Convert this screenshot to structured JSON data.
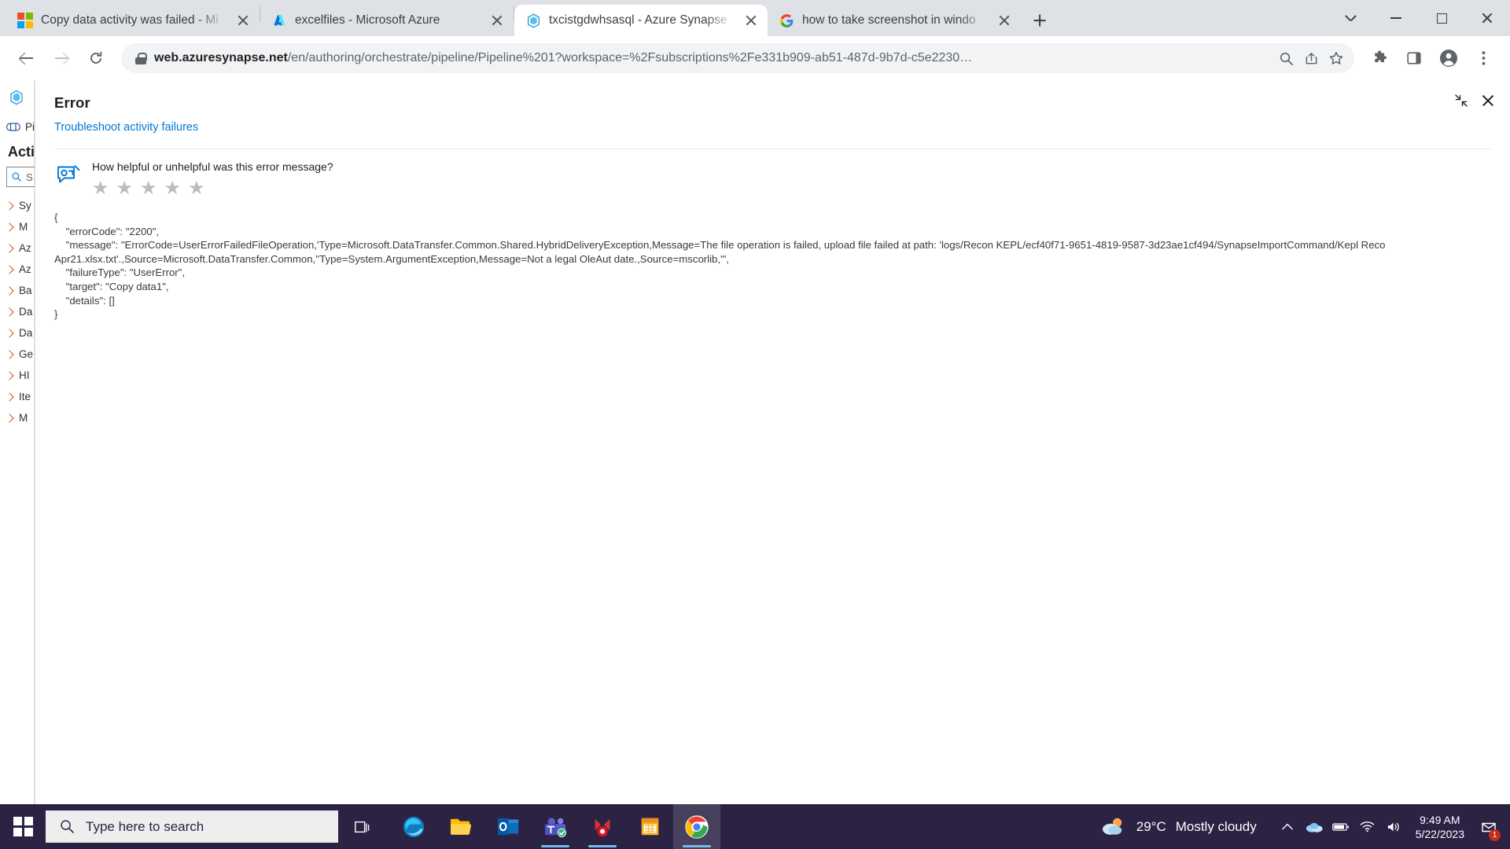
{
  "browser": {
    "tabs": [
      {
        "title": "Copy data activity was failed - Mi",
        "favicon": "microsoft-icon",
        "active": false
      },
      {
        "title": "excelfiles - Microsoft Azure",
        "favicon": "azure-icon",
        "active": false
      },
      {
        "title": "txcistgdwhsasql - Azure Synapse",
        "favicon": "synapse-icon",
        "active": true
      },
      {
        "title": "how to take screenshot in windo",
        "favicon": "google-icon",
        "active": false
      }
    ],
    "new_tab_label": "+",
    "window_controls": {
      "minimize": "–",
      "maximize": "□",
      "close": "✕",
      "tablist": "⌄"
    },
    "toolbar": {
      "back_label": "Back",
      "forward_label": "Forward",
      "reload_label": "Reload",
      "url_domain": "web.azuresynapse.net",
      "url_path": "/en/authoring/orchestrate/pipeline/Pipeline%201?workspace=%2Fsubscriptions%2Fe331b909-ab51-487d-9b7d-c5e2230…",
      "zoom_label": "Search with Google Lens",
      "share_label": "Share this page",
      "bookmark_label": "Bookmark this tab",
      "extensions_label": "Extensions",
      "sidepanel_label": "Side panel",
      "profile_label": "Profile",
      "menu_label": "Customize and control Google Chrome"
    }
  },
  "synapse": {
    "logo": "synapse-icon",
    "pipeline_label": "Pi",
    "panel_heading": "Acti",
    "search_placeholder": "S",
    "tree_items": [
      {
        "label": "Sy"
      },
      {
        "label": "M"
      },
      {
        "label": "Az"
      },
      {
        "label": "Az"
      },
      {
        "label": "Ba"
      },
      {
        "label": "Da"
      },
      {
        "label": "Da"
      },
      {
        "label": "Ge"
      },
      {
        "label": "HI"
      },
      {
        "label": "Ite"
      },
      {
        "label": "M"
      }
    ]
  },
  "error_panel": {
    "title": "Error",
    "troubleshoot_link": "Troubleshoot activity failures",
    "feedback_question": "How helpful or unhelpful was this error message?",
    "stars": [
      "★",
      "★",
      "★",
      "★",
      "★"
    ],
    "stars_selected": 0,
    "star_color": "#bdbdbd",
    "collapse_label": "Collapse",
    "close_label": "Close",
    "json": "{\n    \"errorCode\": \"2200\",\n    \"message\": \"ErrorCode=UserErrorFailedFileOperation,'Type=Microsoft.DataTransfer.Common.Shared.HybridDeliveryException,Message=The file operation is failed, upload file failed at path: 'logs/Recon KEPL/ecf40f71-9651-4819-9587-3d23ae1cf494/SynapseImportCommand/Kepl Reco Apr21.xlsx.txt'.,Source=Microsoft.DataTransfer.Common,''Type=System.ArgumentException,Message=Not a legal OleAut date.,Source=mscorlib,'\",\n    \"failureType\": \"UserError\",\n    \"target\": \"Copy data1\",\n    \"details\": []\n}"
  },
  "taskbar": {
    "start_label": "Start",
    "search_placeholder": "Type here to search",
    "task_view_label": "Task View",
    "apps": [
      {
        "name": "edge-icon"
      },
      {
        "name": "file-explorer-icon"
      },
      {
        "name": "outlook-icon"
      },
      {
        "name": "teams-icon"
      },
      {
        "name": "app-icon"
      },
      {
        "name": "excel-icon"
      },
      {
        "name": "chrome-icon"
      }
    ],
    "weather": {
      "temperature": "29°C",
      "condition": "Mostly cloudy",
      "icon": "partly-cloudy-icon"
    },
    "tray": [
      "show-hidden-icons",
      "onedrive-icon",
      "battery-icon",
      "network-icon",
      "volume-icon"
    ],
    "clock": {
      "time": "9:49 AM",
      "date": "5/22/2023"
    },
    "notification_count": "1"
  }
}
